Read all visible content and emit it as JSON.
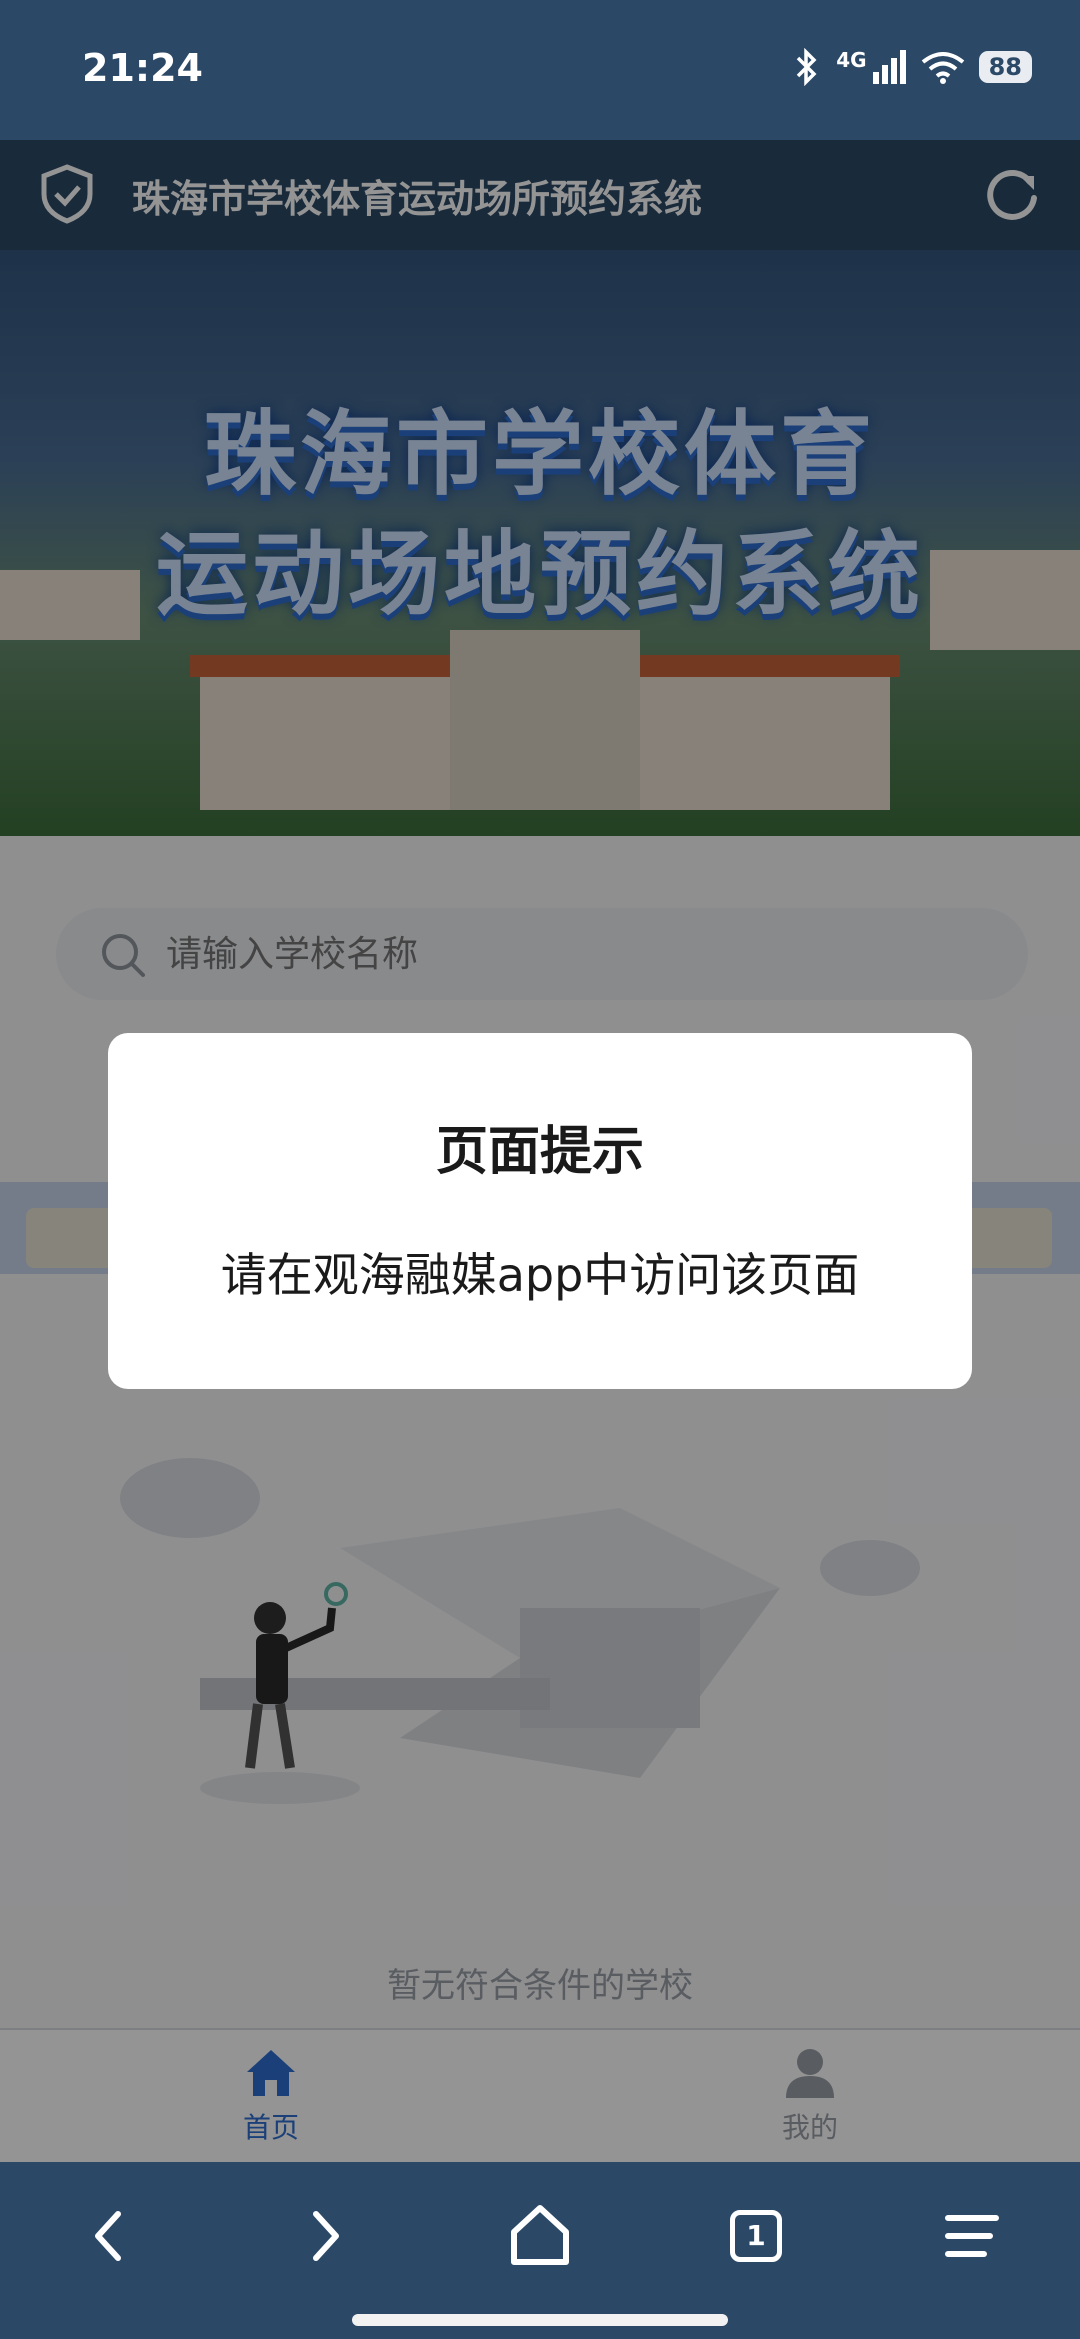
{
  "status_bar": {
    "time": "21:24",
    "network": "4G",
    "battery": "88"
  },
  "header": {
    "title": "珠海市学校体育运动场所预约系统",
    "shield_icon": "shield-check-icon",
    "refresh_icon": "refresh-icon"
  },
  "hero": {
    "line1": "珠海市学校体育",
    "line2": "运动场地预约系统"
  },
  "search": {
    "placeholder": "请输入学校名称",
    "icon": "search-icon"
  },
  "empty_state": {
    "text": "暂无符合条件的学校"
  },
  "tabbar": {
    "items": [
      {
        "label": "首页",
        "icon": "home-icon"
      },
      {
        "label": "我的",
        "icon": "user-icon"
      }
    ]
  },
  "dialog": {
    "title": "页面提示",
    "message": "请在观海融媒app中访问该页面"
  },
  "browser": {
    "tab_count": "1"
  },
  "colors": {
    "header_bg": "#2b4967",
    "accent": "#2f6fd0"
  }
}
